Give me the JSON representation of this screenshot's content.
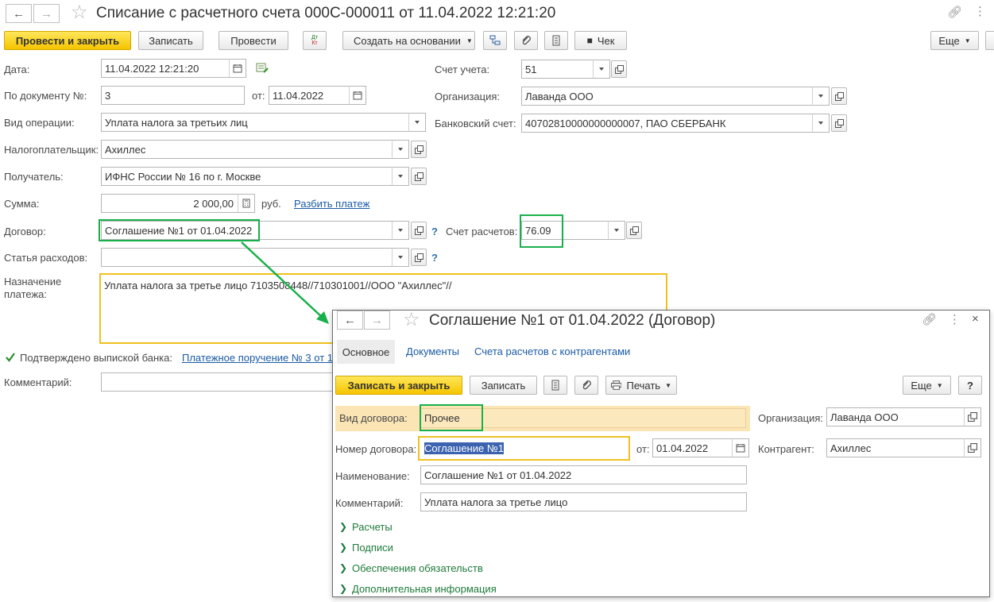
{
  "window": {
    "title": "Списание с расчетного счета 000С-000011 от 11.04.2022 12:21:20"
  },
  "toolbar": {
    "post_close": "Провести и закрыть",
    "save": "Записать",
    "post": "Провести",
    "dtkt_top": "Дт",
    "dtkt_bottom": "Кт",
    "create_based": "Создать на основании",
    "check": "Чек",
    "more": "Еще"
  },
  "form": {
    "date_label": "Дата:",
    "date_value": "11.04.2022 12:21:20",
    "doc_no_label": "По документу №:",
    "doc_no_value": "3",
    "from_label": "от:",
    "from_value": "11.04.2022",
    "op_label": "Вид операции:",
    "op_value": "Уплата налога за третьих лиц",
    "taxpayer_label": "Налогоплательщик:",
    "taxpayer_value": "Ахиллес",
    "recipient_label": "Получатель:",
    "recipient_value": "ИФНС России № 16 по г. Москве",
    "sum_label": "Сумма:",
    "sum_value": "2 000,00",
    "currency": "руб.",
    "split_link": "Разбить платеж",
    "contract_label": "Договор:",
    "contract_value": "Соглашение №1 от 01.04.2022",
    "settle_label": "Счет расчетов:",
    "settle_value": "76.09",
    "expense_label": "Статья расходов:",
    "expense_value": "",
    "purpose_label_1": "Назначение",
    "purpose_label_2": "платежа:",
    "purpose_value": "Уплата налога за третье лицо 7103508448//710301001//ООО \"Ахиллес\"//",
    "confirmed_label": "Подтверждено выпиской банка:",
    "confirmed_link": "Платежное поручение № 3 от 1",
    "comment_label": "Комментарий:",
    "comment_value": "",
    "account_label": "Счет учета:",
    "account_value": "51",
    "org_label": "Организация:",
    "org_value": "Лаванда ООО",
    "bank_label": "Банковский счет:",
    "bank_value": "40702810000000000007, ПАО СБЕРБАНК",
    "qmark": "?"
  },
  "popup": {
    "title": "Соглашение №1 от 01.04.2022 (Договор)",
    "tabs": [
      "Основное",
      "Документы",
      "Счета расчетов с контрагентами"
    ],
    "save_close": "Записать и закрыть",
    "save": "Записать",
    "print": "Печать",
    "more": "Еще",
    "help": "?",
    "kind_label": "Вид договора:",
    "kind_value": "Прочее",
    "org_label": "Организация:",
    "org_value": "Лаванда ООО",
    "number_label": "Номер договора:",
    "number_value": "Соглашение №1",
    "from_label": "от:",
    "from_value": "01.04.2022",
    "counterparty_label": "Контрагент:",
    "counterparty_value": "Ахиллес",
    "name_label": "Наименование:",
    "name_value": "Соглашение №1 от 01.04.2022",
    "comment_label": "Комментарий:",
    "comment_value": "Уплата налога за третье лицо",
    "sections": [
      "Расчеты",
      "Подписи",
      "Обеспечения обязательств",
      "Дополнительная информация"
    ]
  },
  "colors": {
    "accent_yellow": "#f5c400",
    "highlight_green": "#19b04b",
    "highlight_yellow": "#f0c020",
    "link_blue": "#1a5aa6",
    "section_green": "#1e7a3b"
  }
}
